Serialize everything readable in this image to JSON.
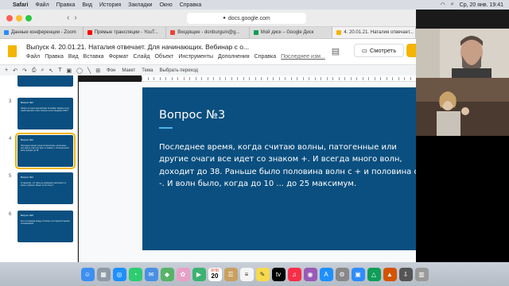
{
  "menubar": {
    "app": "Safari",
    "items": [
      "Файл",
      "Правка",
      "Вид",
      "История",
      "Закладки",
      "Окно",
      "Справка"
    ],
    "datetime": "Ср, 20 янв.  19:41"
  },
  "browser": {
    "url": "docs.google.com",
    "tabs": [
      {
        "label": "Данные конференции - Zoom",
        "color": "#2d8cff"
      },
      {
        "label": "Прямые трансляции - YouT...",
        "color": "#ff0000"
      },
      {
        "label": "Входящие - donburguin@g...",
        "color": "#ea4335"
      },
      {
        "label": "Мой диск – Google Диск",
        "color": "#0f9d58"
      },
      {
        "label": "4. 20.01.21. Наталия отвечает...",
        "color": "#f4b400"
      }
    ]
  },
  "doc": {
    "title": "Выпуск 4. 20.01.21. Наталия отвечает. Для начинающих. Вебинар с о...",
    "menu": [
      "Файл",
      "Правка",
      "Вид",
      "Вставка",
      "Формат",
      "Слайд",
      "Объект",
      "Инструменты",
      "Дополнения",
      "Справка"
    ],
    "last_edit": "Последнее изм...",
    "present_label": "Смотреть"
  },
  "toolbar": {
    "labels": [
      "Фон",
      "Макет",
      "Тема",
      "Выбрать переход"
    ]
  },
  "filmstrip": [
    {
      "num": "",
      "title": "",
      "body": ""
    },
    {
      "num": "3",
      "title": "Вопрос №2",
      "body": "Начать ли отдел над вебинар 10 января. Задача ли на такой практике стоять больше после пандемии 2021?"
    },
    {
      "num": "4",
      "title": "Вопрос №3",
      "body": "Последнее время, когда считаю волны, патогенные или другие очаги все идет со знаком +. И всегда много волн, доходит до 38."
    },
    {
      "num": "5",
      "title": "Вопрос №4",
      "body": "О пределах, что такое до уровневых некоторых и в более глубоком. Может ли это быть?"
    },
    {
      "num": "6",
      "title": "Вопрос №5",
      "body": "Есть ли разница между 1-й волне  и в старыей старыми положениями?"
    }
  ],
  "slide": {
    "title": "Вопрос №3",
    "body": "Последнее время, когда считаю волны, патогенные или другие очаги все идет со знаком +. И всегда много волн, доходит до 38. Раньше было половина волн с + и половина с -. И волн было, когда до 10 ... до 25 максимум."
  },
  "colors": {
    "slide_bg": "#0a4f7f",
    "accent": "#4fb3e8",
    "slides_yellow": "#f4b400"
  }
}
